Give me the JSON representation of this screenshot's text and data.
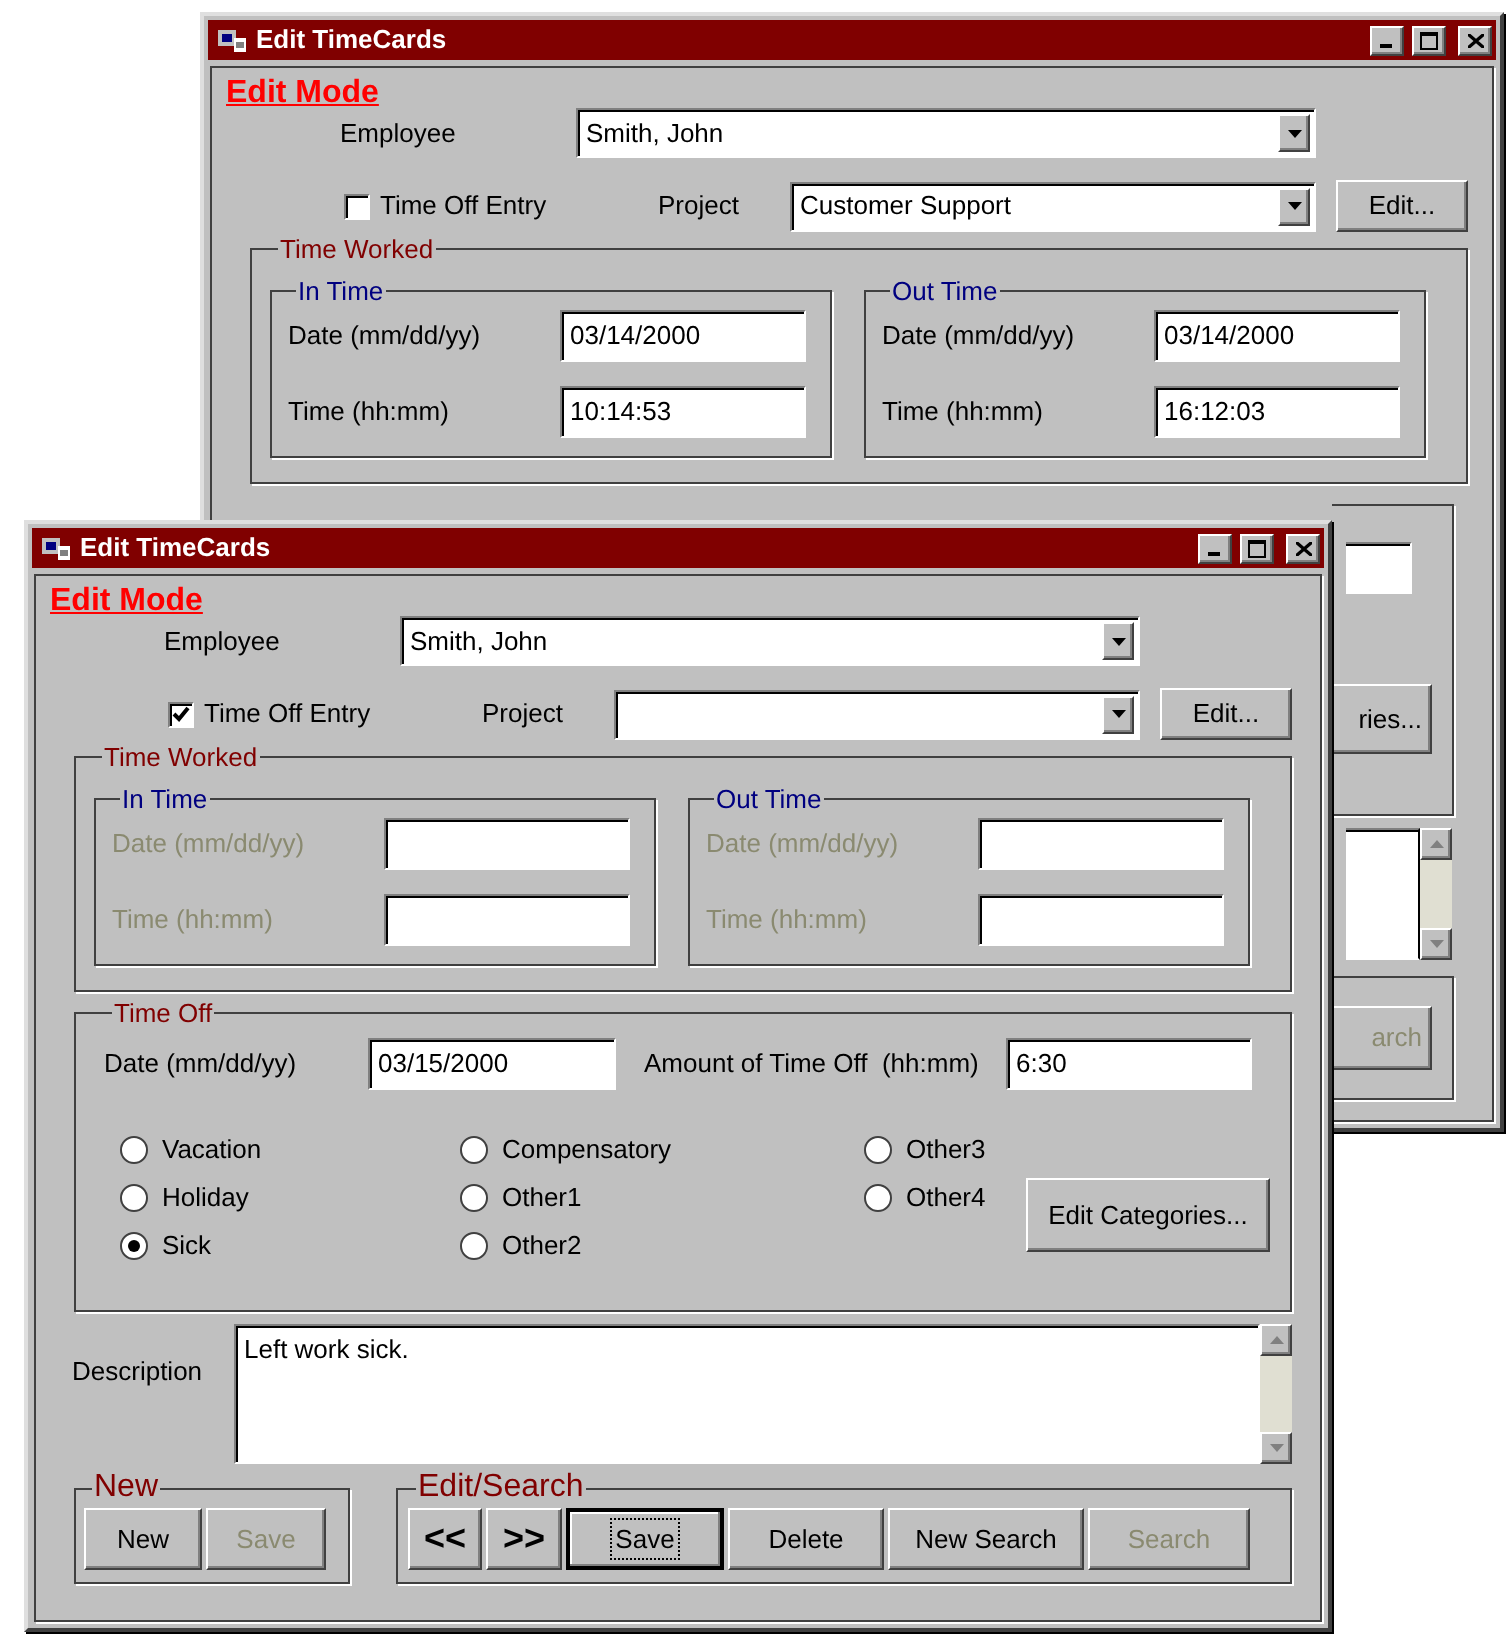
{
  "back_window": {
    "title": "Edit TimeCards",
    "mode": "Edit Mode",
    "employee": {
      "label": "Employee",
      "value": "Smith, John"
    },
    "time_off_entry": {
      "label": "Time Off Entry",
      "checked": false
    },
    "project": {
      "label": "Project",
      "value": "Customer Support"
    },
    "edit_button": "Edit...",
    "time_worked": {
      "title": "Time Worked",
      "disabled": false,
      "in_time": {
        "title": "In Time",
        "date_label": "Date (mm/dd/yy)",
        "date": "03/14/2000",
        "time_label": "Time (hh:mm)",
        "time": "10:14:53"
      },
      "out_time": {
        "title": "Out Time",
        "date_label": "Date (mm/dd/yy)",
        "date": "03/14/2000",
        "time_label": "Time (hh:mm)",
        "time": "16:12:03"
      }
    },
    "categories_button": "ries...",
    "search_button": {
      "label": "arch",
      "disabled": true
    }
  },
  "front_window": {
    "title": "Edit TimeCards",
    "mode": "Edit Mode",
    "employee": {
      "label": "Employee",
      "value": "Smith, John"
    },
    "time_off_entry": {
      "label": "Time Off Entry",
      "checked": true
    },
    "project": {
      "label": "Project"
    },
    "edit_button": "Edit...",
    "time_worked": {
      "title": "Time Worked",
      "disabled": true,
      "in_time": {
        "title": "In Time",
        "date_label": "Date (mm/dd/yy)",
        "time_label": "Time (hh:mm)"
      },
      "out_time": {
        "title": "Out Time",
        "date_label": "Date (mm/dd/yy)",
        "time_label": "Time (hh:mm)"
      }
    },
    "time_off": {
      "title": "Time Off",
      "date_label": "Date (mm/dd/yy)",
      "date": "03/15/2000",
      "amount_label": "Amount of Time Off  (hh:mm)",
      "amount": "6:30",
      "categories": [
        {
          "label": "Vacation",
          "selected": false
        },
        {
          "label": "Holiday",
          "selected": false
        },
        {
          "label": "Sick",
          "selected": true
        },
        {
          "label": "Compensatory",
          "selected": false
        },
        {
          "label": "Other1",
          "selected": false
        },
        {
          "label": "Other2",
          "selected": false
        },
        {
          "label": "Other3",
          "selected": false
        },
        {
          "label": "Other4",
          "selected": false
        }
      ],
      "edit_categories_button": "Edit Categories..."
    },
    "description": {
      "label": "Description",
      "value": "Left work sick."
    },
    "new_group": {
      "title": "New",
      "buttons": [
        {
          "label": "New",
          "disabled": false,
          "focused": false
        },
        {
          "label": "Save",
          "disabled": true,
          "focused": false
        }
      ]
    },
    "edit_search": {
      "title": "Edit/Search",
      "buttons": [
        {
          "label": "<<",
          "disabled": false,
          "focused": false
        },
        {
          "label": ">>",
          "disabled": false,
          "focused": false
        },
        {
          "label": "Save",
          "disabled": false,
          "focused": true
        },
        {
          "label": "Delete",
          "disabled": false,
          "focused": false
        },
        {
          "label": "New Search",
          "disabled": false,
          "focused": false
        },
        {
          "label": "Search",
          "disabled": true,
          "focused": false
        }
      ]
    }
  }
}
